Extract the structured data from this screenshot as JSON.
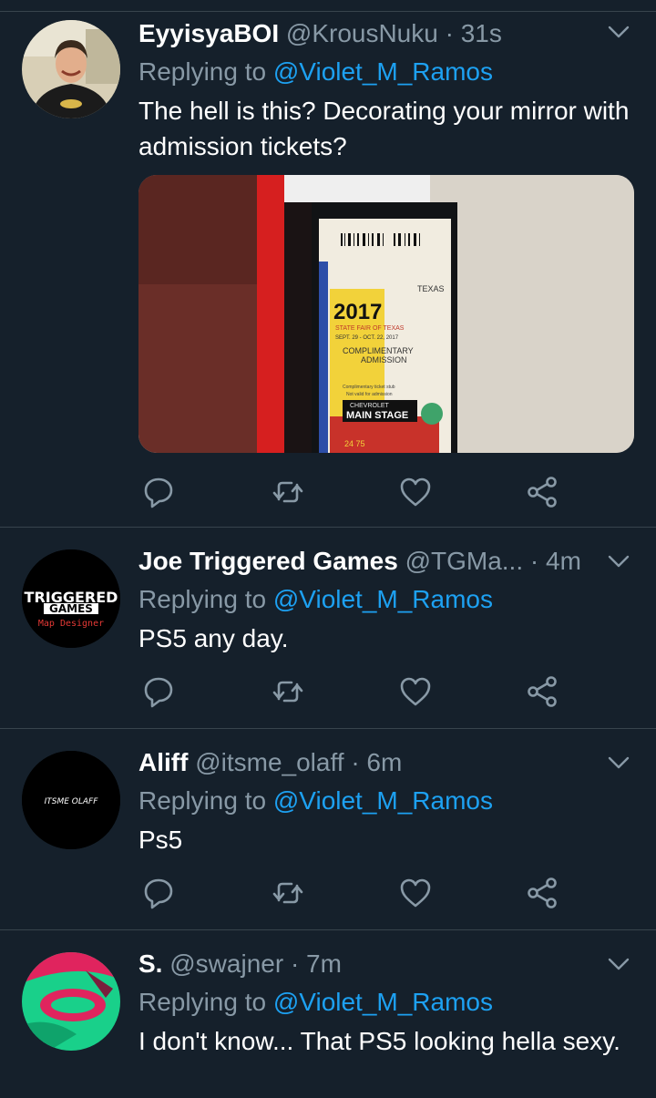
{
  "colors": {
    "background": "#15202b",
    "divider": "#38444d",
    "secondary": "#8899a6",
    "link": "#1da1f2",
    "text": "#ffffff"
  },
  "tweets": [
    {
      "name": "EyyisyaBOI",
      "handle": "@KrousNuku",
      "dot": "·",
      "time": "31s",
      "replying_prefix": "Replying to",
      "replying_to": "@Violet_M_Ramos",
      "text": "The hell is this? Decorating your mirror with admission tickets?",
      "media": {
        "ticket_year": "2017",
        "ticket_line1": "STATE FAIR OF TEXAS",
        "ticket_line2": "SEPT. 29 - OCT. 22, 2017",
        "ticket_line3": "COMPLIMENTARY",
        "ticket_line4": "ADMISSION",
        "ticket_small1": "Complimentary ticket stub",
        "ticket_small2": "Not valid for admission",
        "ticket_sponsor": "CHEVROLET",
        "ticket_stage": "MAIN STAGE",
        "ticket_state": "TEXAS",
        "ticket_nums": "24      75"
      }
    },
    {
      "name": "Joe Triggered Games",
      "handle": "@TGMa...",
      "dot": "·",
      "time": "4m",
      "replying_prefix": "Replying to",
      "replying_to": "@Violet_M_Ramos",
      "text": "PS5 any day.",
      "avatar_line1": "TRIGGERED",
      "avatar_line2": "GAMES",
      "avatar_line3": "Map Designer"
    },
    {
      "name": "Aliff",
      "handle": "@itsme_olaff",
      "dot": "·",
      "time": "6m",
      "replying_prefix": "Replying to",
      "replying_to": "@Violet_M_Ramos",
      "text": "Ps5",
      "avatar_text": "ITSME OLAFF"
    },
    {
      "name": "S.",
      "handle": "@swajner",
      "dot": "·",
      "time": "7m",
      "replying_prefix": "Replying to",
      "replying_to": "@Violet_M_Ramos",
      "text": "I don't know... That PS5 looking hella sexy."
    }
  ],
  "icons": [
    "reply-icon",
    "retweet-icon",
    "like-icon",
    "share-icon",
    "chevron-down-icon"
  ]
}
